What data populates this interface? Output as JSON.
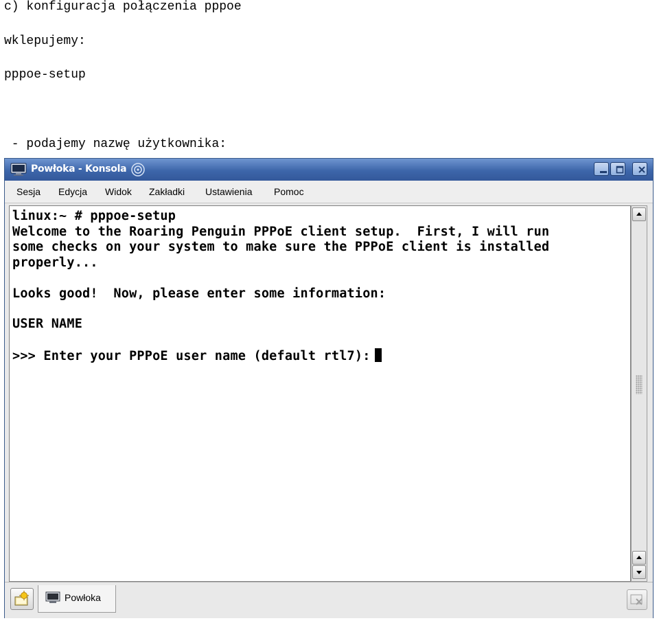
{
  "document": {
    "heading": "c) konfiguracja połączenia pppoe",
    "instruction": "wklepujemy:",
    "command": "pppoe-setup",
    "step": " - podajemy nazwę użytkownika:"
  },
  "window": {
    "title": "Powłoka - Konsola",
    "menu": [
      "Sesja",
      "Edycja",
      "Widok",
      "Zakładki",
      "Ustawienia",
      "Pomoc"
    ]
  },
  "terminal": {
    "lines": [
      "linux:~ # pppoe-setup",
      "Welcome to the Roaring Penguin PPPoE client setup.  First, I will run",
      "some checks on your system to make sure the PPPoE client is installed",
      "properly...",
      "",
      "Looks good!  Now, please enter some information:",
      "",
      "USER NAME",
      "",
      ">>> Enter your PPPoE user name (default rtl7):"
    ]
  },
  "tabs": {
    "active_label": "Powłoka"
  },
  "colors": {
    "titlebar": "#3d66aa",
    "terminal_bg": "#ffffff",
    "terminal_fg": "#000000"
  },
  "icons": {
    "title": "terminal-icon",
    "title_decoration": "swirl-icon",
    "minimize": "minimize-icon",
    "maximize": "maximize-icon",
    "close": "close-icon",
    "new_tab": "new-session-icon",
    "tab": "terminal-icon",
    "close_tab": "close-tab-icon",
    "scroll_up": "arrow-up-icon",
    "scroll_down": "arrow-down-icon"
  }
}
